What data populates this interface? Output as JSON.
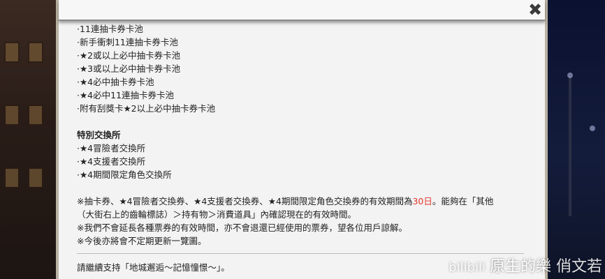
{
  "dialog": {
    "close_label": "✖",
    "pool_list": [
      "·11連抽卡券卡池",
      "·新手衝刺11連抽卡券卡池",
      "·★2或以上必中抽卡券卡池",
      "·★3或以上必中抽卡券卡池",
      "·★4必中抽卡券卡池",
      "·★4必中11連抽卡券卡池",
      "·附有刮獎卡★2以上必中抽卡券卡池"
    ],
    "exchange_heading": "特別交換所",
    "exchange_list": [
      "·★4冒險者交換所",
      "·★4支援者交換所",
      "·★4期間限定角色交換所"
    ],
    "note1_before": "※抽卡券、★4冒險者交換券、★4支援者交換券、★4期間限定角色交換券的有效期間為",
    "note1_highlight": "30日",
    "note1_after": "。能夠在「其他",
    "note1_line2": "（大街右上的齒輪標誌）＞持有物＞消費道具」內確認現在的有效時間。",
    "note2": "※我們不會延長各種票券的有效時間，亦不會退還已經使用的票券，望各位用戶諒解。",
    "note3": "※今後亦將會不定期更新一覽圖。",
    "closing": "請繼續支持「地城邂逅～記憶憧憬～」。"
  },
  "watermark": {
    "logo": "bilibili",
    "text": "原生的樂 俏文若"
  },
  "colors": {
    "highlight": "#e0342b",
    "panel": "#f3f3f3"
  }
}
